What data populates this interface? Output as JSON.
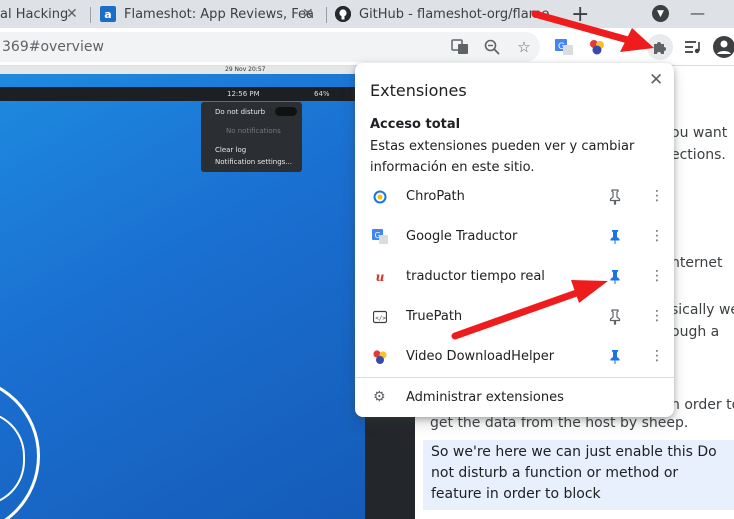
{
  "tabs": [
    {
      "label": "al Hacking",
      "icon": "generic-tab-icon"
    },
    {
      "label": "Flameshot: App Reviews, Fea",
      "icon": "alternativeto-icon",
      "icon_letter": "a"
    },
    {
      "label": "GitHub - flameshot-org/flame",
      "icon": "github-icon"
    }
  ],
  "omnibox": {
    "url": "369#overview"
  },
  "page": {
    "shot_clock": "12:56 PM",
    "shot_battery": "64%",
    "shot_date": "29 Nov 20:57",
    "dnd_panel": {
      "title": "Do not disturb",
      "empty": "No notifications",
      "clear": "Clear log",
      "settings": "Notification settings..."
    },
    "text_lines": [
      "ou want",
      "ections.",
      "nternet",
      "sically we",
      "ough a",
      "n order to",
      "get the data from the host by sheep."
    ],
    "highlight": "So we're here we can just enable this Do not disturb a function or method or feature in order to block"
  },
  "popup": {
    "title": "Extensiones",
    "section": "Acceso total",
    "description": "Estas extensiones pueden ver y cambiar información en este sitio.",
    "extensions": [
      {
        "name": "ChroPath",
        "icon": "chropath-icon",
        "pinned": false
      },
      {
        "name": "Google Traductor",
        "icon": "google-translate-icon",
        "pinned": true
      },
      {
        "name": "traductor tiempo real",
        "icon": "translator-realtime-icon",
        "pinned": true
      },
      {
        "name": "TruePath",
        "icon": "truepath-icon",
        "pinned": false
      },
      {
        "name": "Video DownloadHelper",
        "icon": "video-downloadhelper-icon",
        "pinned": true
      }
    ],
    "manage_label": "Administrar extensiones"
  },
  "colors": {
    "pin_active": "#1a73e8",
    "pin_inactive": "#5f6368",
    "arrow": "#ee1c1c"
  }
}
